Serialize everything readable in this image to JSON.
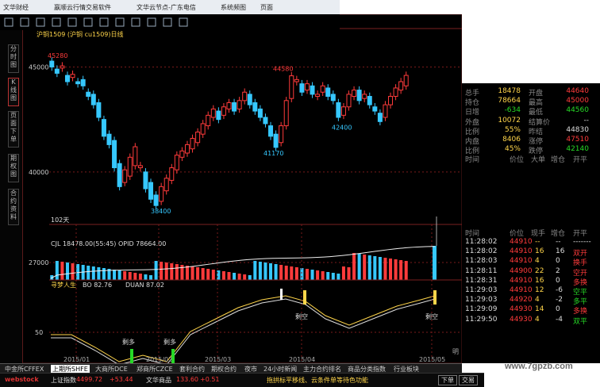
{
  "titlebar": {
    "app": "文华财经",
    "soft": "嬴顺云行情交易软件",
    "node": "文华云节点-广东电信",
    "menu1": "系统频图",
    "menu2": "页面"
  },
  "left_tabs": [
    "分时图",
    "K线图",
    "页面下单",
    "期权图",
    "合约资料"
  ],
  "chart": {
    "header": "沪铜1509 (沪铜  cu1509)日线",
    "price_labels": {
      "p45000": "45000",
      "p40000": "40000",
      "p27000": "27000",
      "p50": "50"
    },
    "annot": {
      "high": "45280",
      "h2": "44580",
      "l1": "41170",
      "l2": "42400",
      "low": "38400"
    },
    "days": "102天",
    "vol_line": "CJL  18478.00(55:45)  OPID  78664.00",
    "ind_line_name": "寻梦人生",
    "ind_bo": "BO  82.76",
    "ind_duan": "DUAN  87.02",
    "ind_labels": [
      "剩多",
      "剩多",
      "剩空",
      "剩空"
    ],
    "dates": [
      "2015/01",
      "2015/02",
      "2015/03",
      "2015/04",
      "2015/05"
    ],
    "right_edge_label": "明"
  },
  "chart_data": {
    "type": "candlestick",
    "title": "沪铜1509 日线",
    "ylim": [
      37500,
      46000
    ],
    "x": [
      "2015/01",
      "2015/02",
      "2015/03",
      "2015/04",
      "2015/05"
    ],
    "annotations": [
      {
        "label": "45280",
        "value": 45280
      },
      {
        "label": "44580",
        "value": 44580
      },
      {
        "label": "41170",
        "value": 41170
      },
      {
        "label": "42400",
        "value": 42400
      },
      {
        "label": "38400",
        "value": 38400
      }
    ],
    "candles": [
      [
        45280,
        45000
      ],
      [
        44900,
        44700
      ],
      [
        44950,
        45050
      ],
      [
        44600,
        44300
      ],
      [
        44500,
        44650
      ],
      [
        44300,
        44200
      ],
      [
        44400,
        44100
      ],
      [
        43800,
        43600
      ],
      [
        43700,
        43200
      ],
      [
        43300,
        42600
      ],
      [
        42500,
        41700
      ],
      [
        41800,
        41300
      ],
      [
        41500,
        40200
      ],
      [
        40400,
        39300
      ],
      [
        39500,
        40100
      ],
      [
        39800,
        40700
      ],
      [
        40300,
        41200
      ],
      [
        40200,
        40300
      ],
      [
        40000,
        39200
      ],
      [
        39500,
        38700
      ],
      [
        38900,
        38400
      ],
      [
        38600,
        39300
      ],
      [
        39100,
        39700
      ],
      [
        39600,
        40200
      ],
      [
        40100,
        40800
      ],
      [
        40700,
        41000
      ],
      [
        40900,
        41300
      ],
      [
        41100,
        41600
      ],
      [
        41400,
        41900
      ],
      [
        41800,
        42300
      ],
      [
        42200,
        42700
      ],
      [
        42600,
        43000
      ],
      [
        42900,
        42500
      ],
      [
        42700,
        43100
      ],
      [
        43000,
        43300
      ],
      [
        43300,
        42900
      ],
      [
        43000,
        43400
      ],
      [
        43400,
        43800
      ],
      [
        43700,
        43200
      ],
      [
        43300,
        42900
      ],
      [
        43000,
        42600
      ],
      [
        42600,
        42300
      ],
      [
        42200,
        41700
      ],
      [
        41800,
        41170
      ],
      [
        41400,
        42200
      ],
      [
        42200,
        43400
      ],
      [
        43500,
        44580
      ],
      [
        44300,
        44400
      ],
      [
        44200,
        43800
      ],
      [
        43900,
        44200
      ],
      [
        44100,
        43700
      ],
      [
        43600,
        43700
      ],
      [
        43800,
        44100
      ],
      [
        44000,
        43600
      ],
      [
        43700,
        43400
      ],
      [
        43300,
        42600
      ],
      [
        42700,
        43100
      ],
      [
        43100,
        43700
      ],
      [
        43600,
        43900
      ],
      [
        43900,
        43400
      ],
      [
        43500,
        43700
      ],
      [
        43600,
        43200
      ],
      [
        43100,
        42900
      ],
      [
        42800,
        42400
      ],
      [
        42600,
        43200
      ],
      [
        43200,
        43600
      ],
      [
        43600,
        44000
      ],
      [
        43900,
        44300
      ],
      [
        44100,
        44600
      ]
    ],
    "series": [
      {
        "name": "CJL",
        "values": [
          18478
        ]
      },
      {
        "name": "OPID",
        "values": [
          78664
        ]
      },
      {
        "name": "BO",
        "values": [
          82.76
        ]
      },
      {
        "name": "DUAN",
        "values": [
          87.02
        ]
      }
    ]
  },
  "quote": {
    "rows": [
      {
        "l1": "总手",
        "v1": "18478",
        "l2": "开盘",
        "v2": "44640"
      },
      {
        "l1": "持仓",
        "v1": "78664",
        "l2": "最高",
        "v2": "45000"
      },
      {
        "l1": "日增",
        "v1": "-634",
        "l2": "最低",
        "v2": "44560"
      },
      {
        "l1": "外盘",
        "v1": "10072",
        "l2": "结算价",
        "v2": "--"
      },
      {
        "l1": "比例",
        "v1": "55%",
        "l2": "昨结",
        "v2": "44830"
      },
      {
        "l1": "内盘",
        "v1": "8406",
        "l2": "涨停",
        "v2": "47510"
      },
      {
        "l1": "比例",
        "v1": "45%",
        "l2": "跌停",
        "v2": "42140"
      }
    ],
    "bigorder_headers": [
      "时间",
      "价位",
      "大单",
      "增仓",
      "开平"
    ],
    "ticks_headers": [
      "时间",
      "价位",
      "现手",
      "增仓",
      "开平"
    ],
    "ticks": [
      {
        "t": "11:28:02",
        "p": "44910",
        "v": "--",
        "z": "--",
        "k": "-------"
      },
      {
        "t": "11:28:02",
        "p": "44910",
        "v": "16",
        "z": "16",
        "k": "双开"
      },
      {
        "t": "11:28:03",
        "p": "44910",
        "v": "4",
        "z": "0",
        "k": "换手"
      },
      {
        "t": "11:28:11",
        "p": "44900",
        "v": "22",
        "z": "2",
        "k": "空开"
      },
      {
        "t": "11:28:31",
        "p": "44910",
        "v": "16",
        "z": "0",
        "k": "多换"
      },
      {
        "t": "11:29:03",
        "p": "44910",
        "v": "12",
        "z": "-6",
        "k": "空平"
      },
      {
        "t": "11:29:03",
        "p": "44920",
        "v": "4",
        "z": "-2",
        "k": "多平"
      },
      {
        "t": "11:29:09",
        "p": "44930",
        "v": "14",
        "z": "0",
        "k": "多换"
      },
      {
        "t": "11:29:50",
        "p": "44930",
        "v": "4",
        "z": "-4",
        "k": "双平"
      }
    ]
  },
  "bottom_tabs": [
    "中金所CFFEX",
    "上期所SHFE",
    "大商所DCE",
    "郑商所CZCE",
    "套利合约",
    "期权合约",
    "夜市",
    "24小时新闻",
    "主力合约排名",
    "商品分类指数",
    "行业板块"
  ],
  "statusbar": {
    "logo": "webstock",
    "item1_label": "上证指数",
    "item1_value": "4499.72",
    "item1_change": "+53.44",
    "item2_label": "文华商品",
    "item2_value": "133.60",
    "item2_change": "+0.51",
    "ticker": "拖拱标平移线、云条件单等待色功能",
    "btn_order": "下单",
    "btn_trade": "交易"
  },
  "watermark": "www.7gpzb.com"
}
